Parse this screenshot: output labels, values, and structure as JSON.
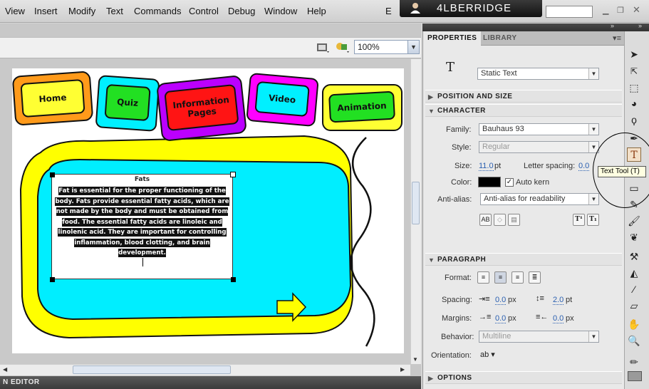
{
  "menu": [
    "View",
    "Insert",
    "Modify",
    "Text",
    "Commands",
    "Control",
    "Debug",
    "Window",
    "Help"
  ],
  "menu_overflow": "E",
  "user": {
    "name": "4LBERRIDGE"
  },
  "zoom": {
    "value": "100%"
  },
  "bottom_tab": "N EDITOR",
  "stage": {
    "buttons": [
      "Home",
      "Quiz",
      "Information Pages",
      "Video",
      "Animation"
    ],
    "facts_title": "Fats",
    "facts_body": "Fat is essential for the proper functioning of the body. Fats provide essential fatty acids, which are not made by the body and must be obtained from food. The essential fatty acids are linoleic and linolenic acid. They are important for controlling inflammation, blood clotting, and brain development."
  },
  "properties": {
    "tabs": [
      "PROPERTIES",
      "LIBRARY"
    ],
    "tool_glyph": "T",
    "text_type": "Static Text",
    "sections": {
      "position": "POSITION AND SIZE",
      "character": "CHARACTER",
      "paragraph": "PARAGRAPH",
      "options": "OPTIONS"
    },
    "character": {
      "family_label": "Family:",
      "family_value": "Bauhaus 93",
      "style_label": "Style:",
      "style_value": "Regular",
      "size_label": "Size:",
      "size_value": "11.0",
      "size_unit": "pt",
      "letter_spacing_label": "Letter spacing:",
      "letter_spacing_value": "0.0",
      "color_label": "Color:",
      "color_hex": "#000000",
      "auto_kern_label": "Auto kern",
      "anti_alias_label": "Anti-alias:",
      "anti_alias_value": "Anti-alias for readability"
    },
    "paragraph": {
      "format_label": "Format:",
      "spacing_label": "Spacing:",
      "spacing_indent": "0.0",
      "spacing_indent_unit": "px",
      "spacing_line": "2.0",
      "spacing_line_unit": "pt",
      "margins_label": "Margins:",
      "margin_left": "0.0",
      "margin_left_unit": "px",
      "margin_right": "0.0",
      "margin_right_unit": "px",
      "behavior_label": "Behavior:",
      "behavior_value": "Multiline",
      "orientation_label": "Orientation:"
    }
  },
  "tooltip": "Text Tool (T)"
}
